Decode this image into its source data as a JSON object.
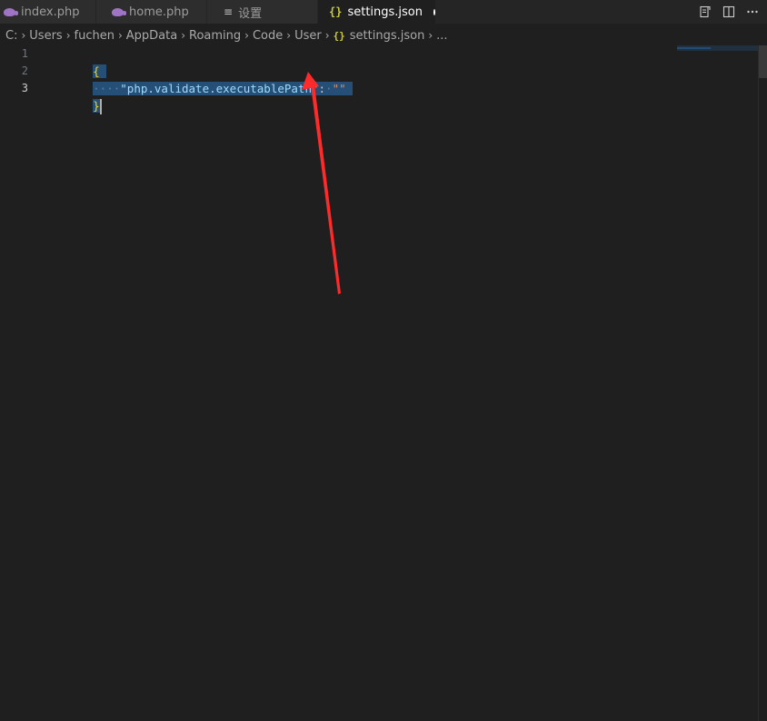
{
  "tabs": [
    {
      "label": "index.php",
      "icon": "php-elephant-icon"
    },
    {
      "label": "home.php",
      "icon": "php-elephant-icon"
    },
    {
      "label": "设置",
      "icon": "settings-lines-icon"
    },
    {
      "label": "settings.json",
      "icon": "json-braces-icon",
      "active": true,
      "dirty": true
    }
  ],
  "tab_actions": [
    {
      "icon": "open-changes-icon"
    },
    {
      "icon": "split-editor-icon"
    },
    {
      "icon": "more-actions-icon"
    }
  ],
  "breadcrumb": {
    "parts": [
      "C:",
      "Users",
      "fuchen",
      "AppData",
      "Roaming",
      "Code",
      "User"
    ],
    "file": "settings.json",
    "more": "..."
  },
  "editor": {
    "line_numbers": [
      "1",
      "2",
      "3"
    ],
    "line1": "{",
    "line2_indent": "····",
    "line2_key": "\"php.validate.executablePath\"",
    "line2_colon": ":",
    "line2_value": "\"\"",
    "line3": "}"
  },
  "annotation": {
    "type": "red-arrow",
    "color": "#ff2a2a"
  },
  "colors": {
    "selection": "#264f78",
    "brace": "#ffd700",
    "json_key": "#9cdcfe",
    "string": "#ce9178",
    "background": "#1f1f1f"
  }
}
